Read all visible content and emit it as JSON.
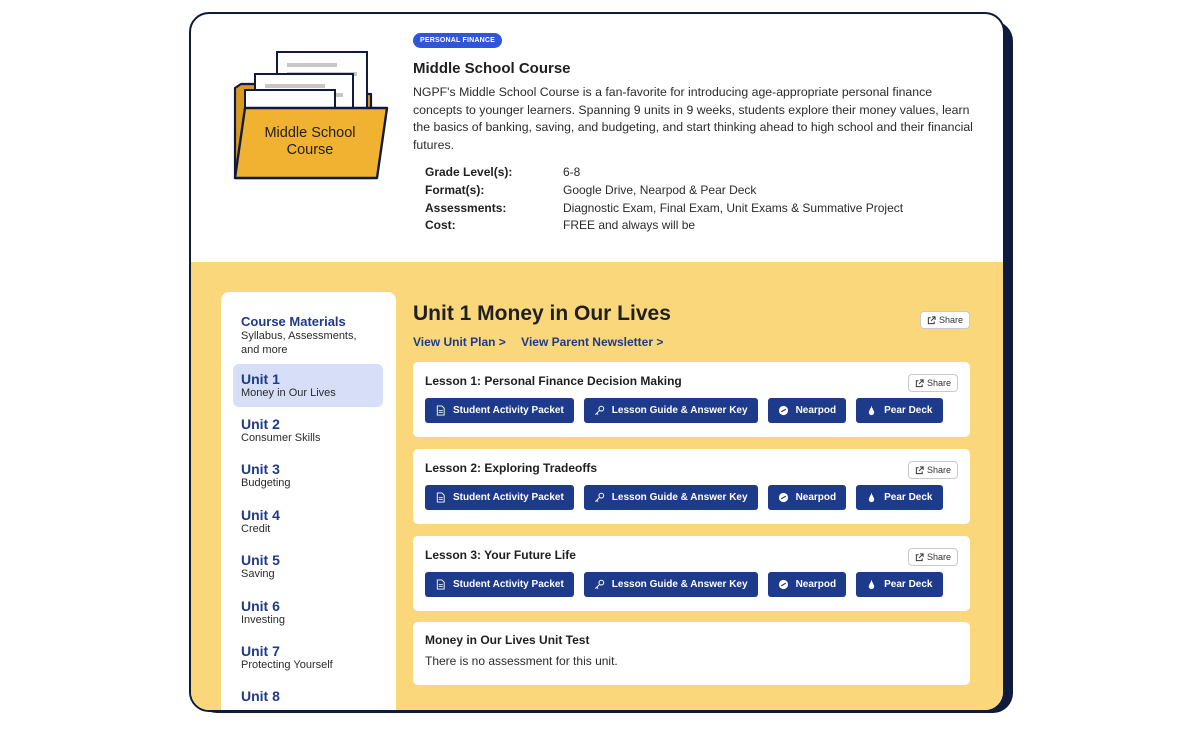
{
  "course": {
    "badge": "PERSONAL FINANCE",
    "folder_label_line1": "Middle School",
    "folder_label_line2": "Course",
    "title": "Middle School Course",
    "description": "NGPF's Middle School Course is a fan-favorite for introducing age-appropriate personal finance concepts to younger learners. Spanning 9 units in 9 weeks, students explore their money values, learn the basics of banking, saving, and budgeting, and start thinking ahead to high school and their financial futures.",
    "meta": [
      {
        "label": "Grade Level(s):",
        "value": "6-8"
      },
      {
        "label": "Format(s):",
        "value": "Google Drive, Nearpod & Pear Deck"
      },
      {
        "label": "Assessments:",
        "value": "Diagnostic Exam, Final Exam, Unit Exams & Summative Project"
      },
      {
        "label": "Cost:",
        "value": "FREE  and always will be"
      }
    ]
  },
  "sidebar": {
    "materials_title": "Course Materials",
    "materials_sub_line1": "Syllabus, Assessments,",
    "materials_sub_line2": "and more",
    "units": [
      {
        "title": "Unit 1",
        "sub": "Money in Our Lives"
      },
      {
        "title": "Unit 2",
        "sub": "Consumer Skills"
      },
      {
        "title": "Unit 3",
        "sub": "Budgeting"
      },
      {
        "title": "Unit 4",
        "sub": "Credit"
      },
      {
        "title": "Unit 5",
        "sub": "Saving"
      },
      {
        "title": "Unit 6",
        "sub": "Investing"
      },
      {
        "title": "Unit 7",
        "sub": "Protecting Yourself"
      },
      {
        "title": "Unit 8",
        "sub": ""
      }
    ]
  },
  "unit": {
    "title": "Unit 1 Money in Our Lives",
    "link_plan": "View Unit Plan >",
    "link_newsletter": "View Parent Newsletter >",
    "share_label": "Share",
    "button_labels": {
      "packet": "Student Activity Packet",
      "guide": "Lesson Guide & Answer Key",
      "nearpod": "Nearpod",
      "peardeck": "Pear Deck"
    },
    "lessons": [
      {
        "title": "Lesson 1: Personal Finance Decision Making"
      },
      {
        "title": "Lesson 2: Exploring Tradeoffs"
      },
      {
        "title": "Lesson 3: Your Future Life"
      }
    ],
    "test_title": "Money in Our Lives Unit Test",
    "test_text": "There is no assessment for this unit."
  },
  "colors": {
    "navy": "#1e3a8a",
    "yellow": "#f9d77a",
    "folder": "#f0b230",
    "badge": "#2f56d9"
  }
}
